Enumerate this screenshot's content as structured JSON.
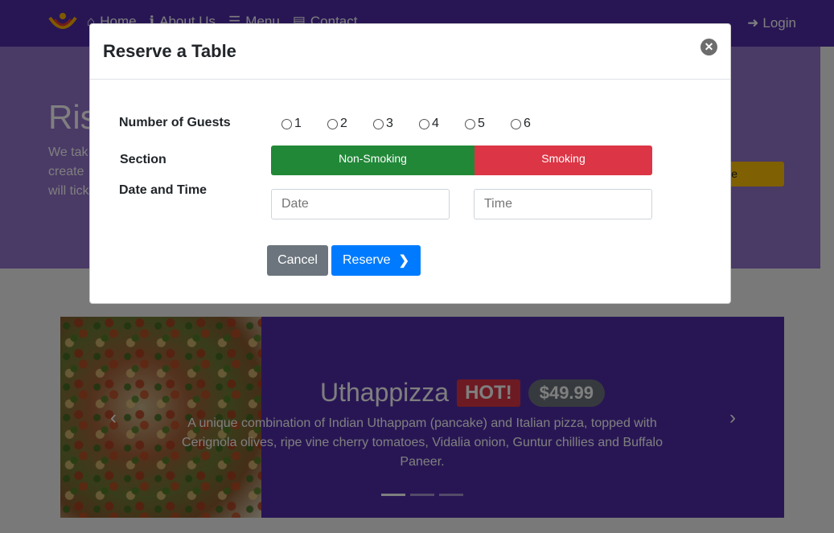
{
  "nav": {
    "items": [
      {
        "icon": "home-icon",
        "label": "Home"
      },
      {
        "icon": "info-icon",
        "label": "About Us"
      },
      {
        "icon": "list-icon",
        "label": "Menu"
      },
      {
        "icon": "address-card-icon",
        "label": "Contact"
      }
    ],
    "login_label": "Login"
  },
  "jumbotron": {
    "title": "Ris",
    "text_lines": [
      "We tak",
      "create",
      "will tick"
    ],
    "button_label": "e"
  },
  "carousel": {
    "name": "Uthappizza",
    "badge": "HOT!",
    "price": "$49.99",
    "description": "A unique combination of Indian Uthappam (pancake) and Italian pizza, topped with Cerignola olives, ripe vine cherry tomatoes, Vidalia onion, Guntur chillies and Buffalo Paneer.",
    "active_indicator": 0
  },
  "modal": {
    "title": "Reserve a Table",
    "guests_label": "Number of Guests",
    "guest_options": [
      "1",
      "2",
      "3",
      "4",
      "5",
      "6"
    ],
    "section_label": "Section",
    "section_options": [
      "Non-Smoking",
      "Smoking"
    ],
    "datetime_label": "Date and Time",
    "date_placeholder": "Date",
    "time_placeholder": "Time",
    "cancel_label": "Cancel",
    "reserve_label": "Reserve"
  },
  "colors": {
    "navbar": "#512da8",
    "jumbotron": "#9575cd",
    "non_smoking": "#218838",
    "smoking": "#dc3545",
    "reserve_button": "#007bff",
    "cancel_button": "#6c757d"
  }
}
